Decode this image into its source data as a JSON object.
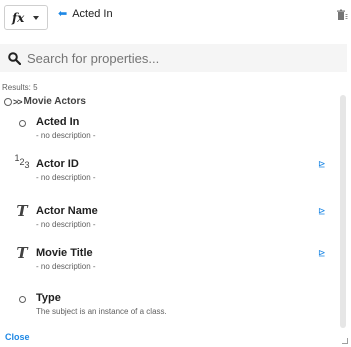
{
  "toolbar": {
    "fx_label": "fx",
    "back_label": "Acted In",
    "colors": {
      "accent": "#1e88e5"
    }
  },
  "search": {
    "value": "",
    "placeholder": "Search for properties..."
  },
  "results_label": "Results: 5",
  "group": {
    "label": "Movie Actors"
  },
  "properties": [
    {
      "name": "Acted In",
      "description": "- no description -",
      "icon": "circle-icon",
      "has_filter": false
    },
    {
      "name": "Actor ID",
      "description": "- no description -",
      "icon": "number-type-icon",
      "has_filter": true
    },
    {
      "name": "Actor Name",
      "description": "- no description -",
      "icon": "text-type-icon",
      "has_filter": true
    },
    {
      "name": "Movie Title",
      "description": "- no description -",
      "icon": "text-type-icon",
      "has_filter": true
    },
    {
      "name": "Type",
      "description": "The subject is an instance of a class.",
      "icon": "circle-icon",
      "has_filter": false
    }
  ],
  "close_label": "Close"
}
